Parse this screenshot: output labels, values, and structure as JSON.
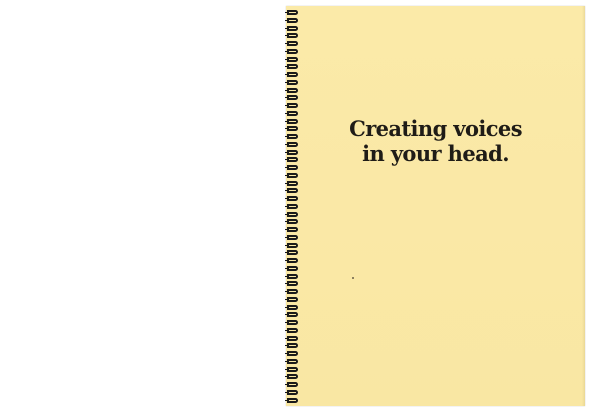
{
  "notebook": {
    "cover_title_line1": "Creating voices",
    "cover_title_line2": "in your head.",
    "cover_color": "#fae8a6",
    "coil_color": "#1a1a1a",
    "binding": "spiral"
  }
}
